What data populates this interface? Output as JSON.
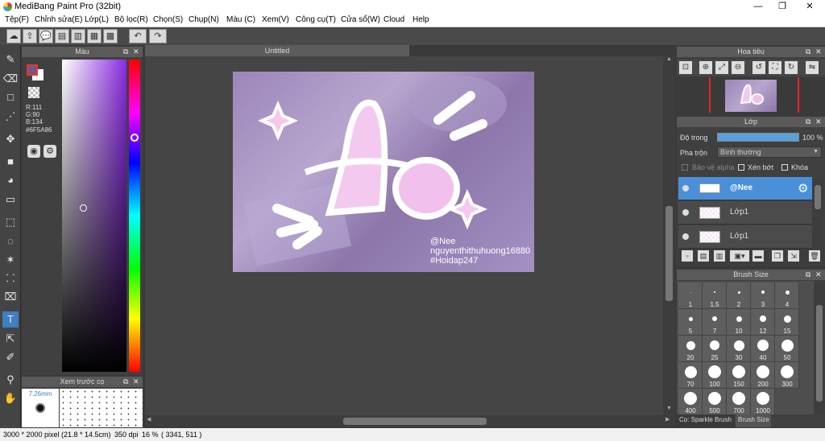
{
  "app": {
    "title": "MediBang Paint Pro (32bit)"
  },
  "window_controls": {
    "minimize": "—",
    "maximize": "❐",
    "close": "✕"
  },
  "menu": [
    "Tệp(F)",
    "Chỉnh sửa(E)",
    "Lớp(L)",
    "Bộ lọc(R)",
    "Chọn(S)",
    "Chụp(N)",
    "Màu (C)",
    "Xem(V)",
    "Công cụ(T)",
    "Cửa sổ(W)",
    "Cloud",
    "Help"
  ],
  "toolbar_icons": [
    "cloud-icon",
    "share-icon",
    "chat-icon",
    "comment-icon",
    "page-icon",
    "panel-icon",
    "grid-icon",
    "undo-icon",
    "redo-icon"
  ],
  "tools": [
    "brush-icon",
    "eraser-icon",
    "rectangle-icon",
    "dot-brush-icon",
    "move-icon",
    "fill-rect-icon",
    "bucket-icon",
    "gradient-icon",
    "select-rect-icon",
    "lasso-icon",
    "magic-wand-icon",
    "select-pen-icon",
    "select-eraser-icon",
    "text-icon",
    "operation-icon",
    "dropper-icon",
    "eyedropper-icon",
    "hand-icon"
  ],
  "color_panel": {
    "title": "Màu",
    "r": "R:111",
    "g": "G:90",
    "b": "B:134",
    "hex": "#6F5A86",
    "fg_color": "#6F5A86",
    "bg_color": "#FFFFFF"
  },
  "brush_preview": {
    "title": "Xem trước cọ",
    "size": "7.26mm"
  },
  "canvas": {
    "tab": "Untitled",
    "watermark": [
      "@Nee",
      "nguyenthithuhuong16880",
      "#Hoidap247"
    ]
  },
  "navigator": {
    "title": "Hoa tiêu"
  },
  "layers": {
    "title": "Lớp",
    "opacity_label": "Độ trong",
    "opacity_value": "100 %",
    "opacity_fraction": 1.0,
    "blend_label": "Pha trộn",
    "blend_value": "Bình thường",
    "protect_alpha": "Bảo vệ alpha",
    "clipping": "Xén bớt",
    "lock": "Khóa",
    "items": [
      {
        "name": "@Nee",
        "selected": true
      },
      {
        "name": "Lớp1",
        "selected": false
      },
      {
        "name": "Lớp1",
        "selected": false
      }
    ]
  },
  "brush_size": {
    "title": "Brush Size",
    "sizes": [
      "1",
      "1.5",
      "2",
      "3",
      "4",
      "5",
      "7",
      "10",
      "12",
      "15",
      "20",
      "25",
      "30",
      "40",
      "50",
      "70",
      "100",
      "150",
      "200",
      "300",
      "400",
      "500",
      "700",
      "1000"
    ],
    "tabs": [
      "Cọ: Sparkle Brush",
      "Brush Size"
    ]
  },
  "status": {
    "dims": "3000 * 2000 pixel",
    "cm": "(21.8 * 14.5cm)",
    "dpi": "350 dpi",
    "zoom": "16 %",
    "coords": "( 3341, 511 )"
  }
}
